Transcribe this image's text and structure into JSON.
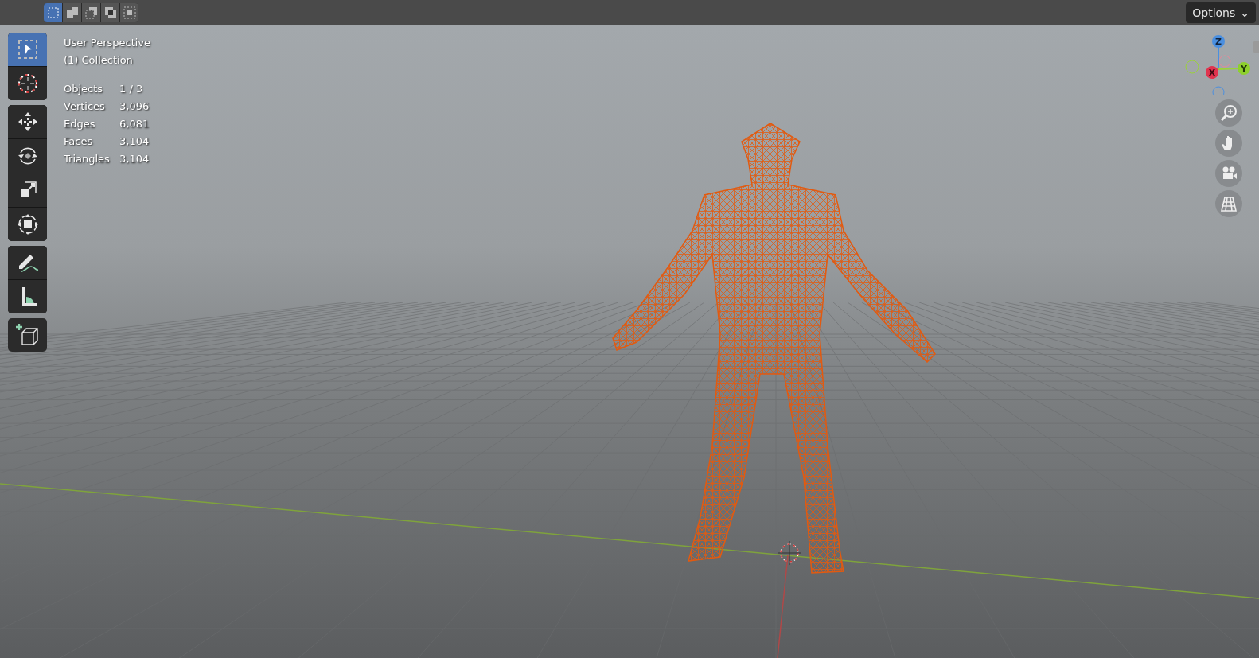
{
  "header": {
    "select_modes": [
      {
        "kind": "new",
        "selected": true
      },
      {
        "kind": "extend",
        "selected": false
      },
      {
        "kind": "subtract",
        "selected": false
      },
      {
        "kind": "invert",
        "selected": false
      },
      {
        "kind": "intersect",
        "selected": false
      }
    ],
    "options_button": {
      "label": "Options",
      "caret": "⌄"
    }
  },
  "viewport": {
    "view_name": "User Perspective",
    "collection": "(1) Collection",
    "stats": [
      {
        "label": "Objects",
        "value": "1 / 3"
      },
      {
        "label": "Vertices",
        "value": "3,096"
      },
      {
        "label": "Edges",
        "value": "6,081"
      },
      {
        "label": "Faces",
        "value": "3,104"
      },
      {
        "label": "Triangles",
        "value": "3,104"
      }
    ],
    "toolbar": [
      [
        {
          "kind": "select",
          "selected": true
        },
        {
          "kind": "cursor",
          "selected": false
        }
      ],
      [
        {
          "kind": "move",
          "selected": false
        },
        {
          "kind": "rotate",
          "selected": false
        },
        {
          "kind": "scale",
          "selected": false
        },
        {
          "kind": "transform",
          "selected": false
        }
      ],
      [
        {
          "kind": "annotate",
          "selected": false
        },
        {
          "kind": "measure",
          "selected": false
        }
      ],
      [
        {
          "kind": "add-cube",
          "selected": false
        }
      ]
    ],
    "gizmo": {
      "z": "Z",
      "x": "X",
      "y": "Y"
    },
    "nav_buttons": [
      {
        "kind": "zoom"
      },
      {
        "kind": "hand"
      },
      {
        "kind": "camera"
      },
      {
        "kind": "grid"
      }
    ]
  }
}
